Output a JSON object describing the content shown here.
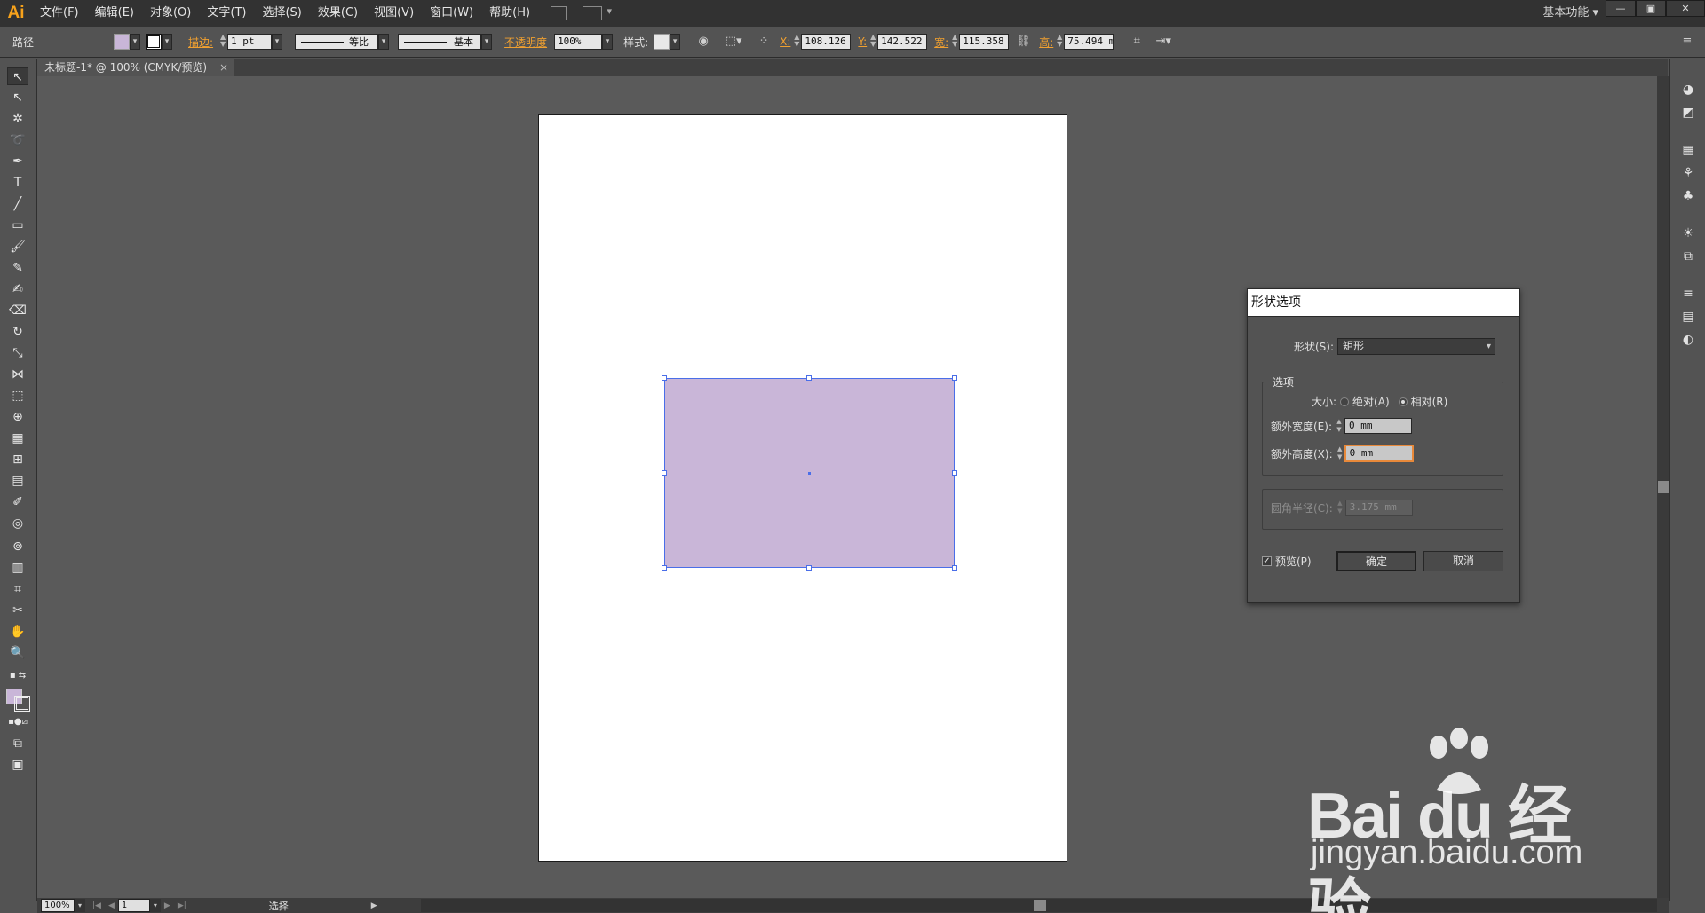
{
  "app": {
    "logo": "Ai",
    "workspace": "基本功能 ▾"
  },
  "menu": [
    "文件(F)",
    "编辑(E)",
    "对象(O)",
    "文字(T)",
    "选择(S)",
    "效果(C)",
    "视图(V)",
    "窗口(W)",
    "帮助(H)"
  ],
  "window_buttons": [
    "—",
    "▣",
    "✕"
  ],
  "control": {
    "object_type": "路径",
    "fill_color": "#c9b6d8",
    "stroke_label": "描边:",
    "stroke_weight": "1 pt",
    "profile_label": "等比",
    "brush_label": "基本",
    "opacity_label": "不透明度",
    "opacity_value": "100%",
    "style_label": "样式:",
    "x_label": "X:",
    "x_value": "108.126 r",
    "y_label": "Y:",
    "y_value": "142.522 r",
    "w_label": "宽:",
    "w_value": "115.358 r",
    "h_label": "高:",
    "h_value": "75.494 m"
  },
  "document_tab": {
    "title": "未标题-1* @ 100% (CMYK/预览)",
    "close": "×"
  },
  "artwork": {
    "rect_fill": "#c9b6d8",
    "selection_color": "#4a6ee8"
  },
  "dialog": {
    "title": "形状选项",
    "shape_label": "形状(S):",
    "shape_value": "矩形",
    "options_group": "选项",
    "size_label": "大小:",
    "absolute_label": "绝对(A)",
    "relative_label": "相对(R)",
    "size_mode": "relative",
    "extra_width_label": "额外宽度(E):",
    "extra_width_value": "0 mm",
    "extra_height_label": "额外高度(X):",
    "extra_height_value": "0 mm",
    "corner_label": "圆角半径(C):",
    "corner_value": "3.175 mm",
    "preview_label": "预览(P)",
    "preview_checked": true,
    "ok_label": "确定",
    "cancel_label": "取消"
  },
  "status": {
    "zoom": "100%",
    "artboard": "1",
    "mode": "选择"
  },
  "watermark": {
    "brand": "Bai  du 经验",
    "url": "jingyan.baidu.com"
  }
}
